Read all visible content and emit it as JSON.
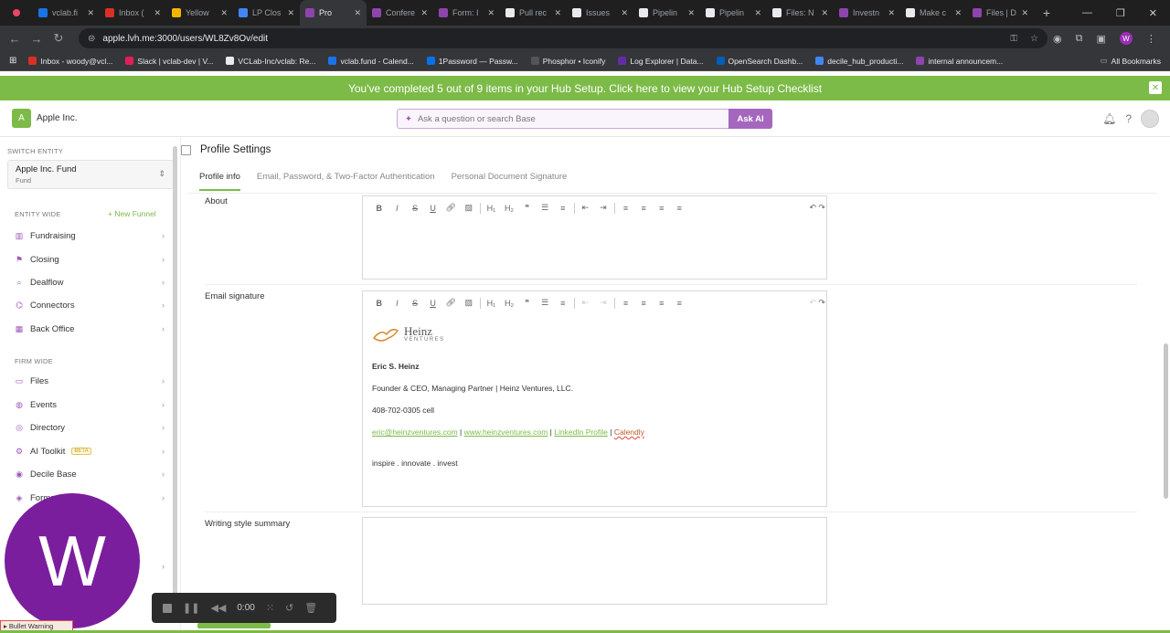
{
  "browser": {
    "tabs": [
      {
        "title": "vclab.fi",
        "color": "#1a73e8",
        "active": false
      },
      {
        "title": "Inbox (",
        "color": "#d93025",
        "active": false
      },
      {
        "title": "Yellow",
        "color": "#f4b400",
        "active": false
      },
      {
        "title": "LP Clos",
        "color": "#4285f4",
        "active": false
      },
      {
        "title": "Pro",
        "color": "#8e44ad",
        "active": true
      },
      {
        "title": "Confere",
        "color": "#8e44ad",
        "active": false
      },
      {
        "title": "Form: I",
        "color": "#8e44ad",
        "active": false
      },
      {
        "title": "Pull rec",
        "color": "#e8eaed",
        "active": false
      },
      {
        "title": "Issues",
        "color": "#e8eaed",
        "active": false
      },
      {
        "title": "Pipelin",
        "color": "#e8eaed",
        "active": false
      },
      {
        "title": "Pipelin",
        "color": "#e8eaed",
        "active": false
      },
      {
        "title": "Files: N",
        "color": "#e8eaed",
        "active": false
      },
      {
        "title": "Investn",
        "color": "#8e44ad",
        "active": false
      },
      {
        "title": "Make c",
        "color": "#e8eaed",
        "active": false
      },
      {
        "title": "Files | D",
        "color": "#8e44ad",
        "active": false
      }
    ],
    "url": "apple.lvh.me:3000/users/WL8Zv8Ov/edit",
    "profile_initial": "W",
    "bookmarks": [
      {
        "label": "Inbox - woody@vcl...",
        "color": "#d93025"
      },
      {
        "label": "Slack | vclab-dev | V...",
        "color": "#e01e5a"
      },
      {
        "label": "VCLab-Inc/vclab: Re...",
        "color": "#e8eaed"
      },
      {
        "label": "vclab.fund - Calend...",
        "color": "#1a73e8"
      },
      {
        "label": "1Password — Passw...",
        "color": "#0572ec"
      },
      {
        "label": "Phosphor • Iconify",
        "color": "#555"
      },
      {
        "label": "Log Explorer | Data...",
        "color": "#632ca6"
      },
      {
        "label": "OpenSearch Dashb...",
        "color": "#005eb8"
      },
      {
        "label": "decile_hub_producti...",
        "color": "#4285f4"
      },
      {
        "label": "internal announcem...",
        "color": "#8e44ad"
      }
    ],
    "all_bookmarks": "All Bookmarks"
  },
  "banner": {
    "text": "You've completed 5 out of 9 items in your Hub Setup. Click here to view your Hub Setup Checklist",
    "close": "✕"
  },
  "topbar": {
    "entity_initial": "A",
    "entity_name": "Apple Inc.",
    "search_placeholder": "Ask a question or search Base",
    "ask_ai": "Ask AI"
  },
  "sidebar": {
    "switch_entity_label": "SWITCH ENTITY",
    "entity_name": "Apple Inc. Fund",
    "entity_type": "Fund",
    "entity_wide_label": "ENTITY WIDE",
    "new_funnel": "+ New Funnel",
    "entity_items": [
      "Fundraising",
      "Closing",
      "Dealflow",
      "Connectors",
      "Back Office"
    ],
    "firm_wide_label": "FIRM WIDE",
    "firm_items": [
      "Files",
      "Events",
      "Directory",
      "AI Toolkit",
      "Decile Base",
      "Forms"
    ],
    "beta": "BETA"
  },
  "main": {
    "title": "Profile Settings",
    "tabs": [
      "Profile info",
      "Email, Password, & Two-Factor Authentication",
      "Personal Document Signature"
    ],
    "about_label": "About",
    "email_signature_label": "Email signature",
    "writing_style_label": "Writing style summary",
    "signature": {
      "logo_word": "Heinz",
      "logo_sub": "VENTURES",
      "name": "Eric S. Heinz",
      "title": "Founder & CEO, Managing Partner | Heinz Ventures, LLC.",
      "phone": "408-702-0305 cell",
      "email": "eric@heinzventures.com",
      "website": "www.heinzventures.com",
      "linkedin": "LinkedIn Profile",
      "calendly": "Calendly",
      "divider": "|",
      "tagline": "inspire . innovate . invest"
    }
  },
  "overlay": {
    "avatar_letter": "W",
    "timer": "0:00",
    "warning": "▸ Bullet Warning"
  }
}
